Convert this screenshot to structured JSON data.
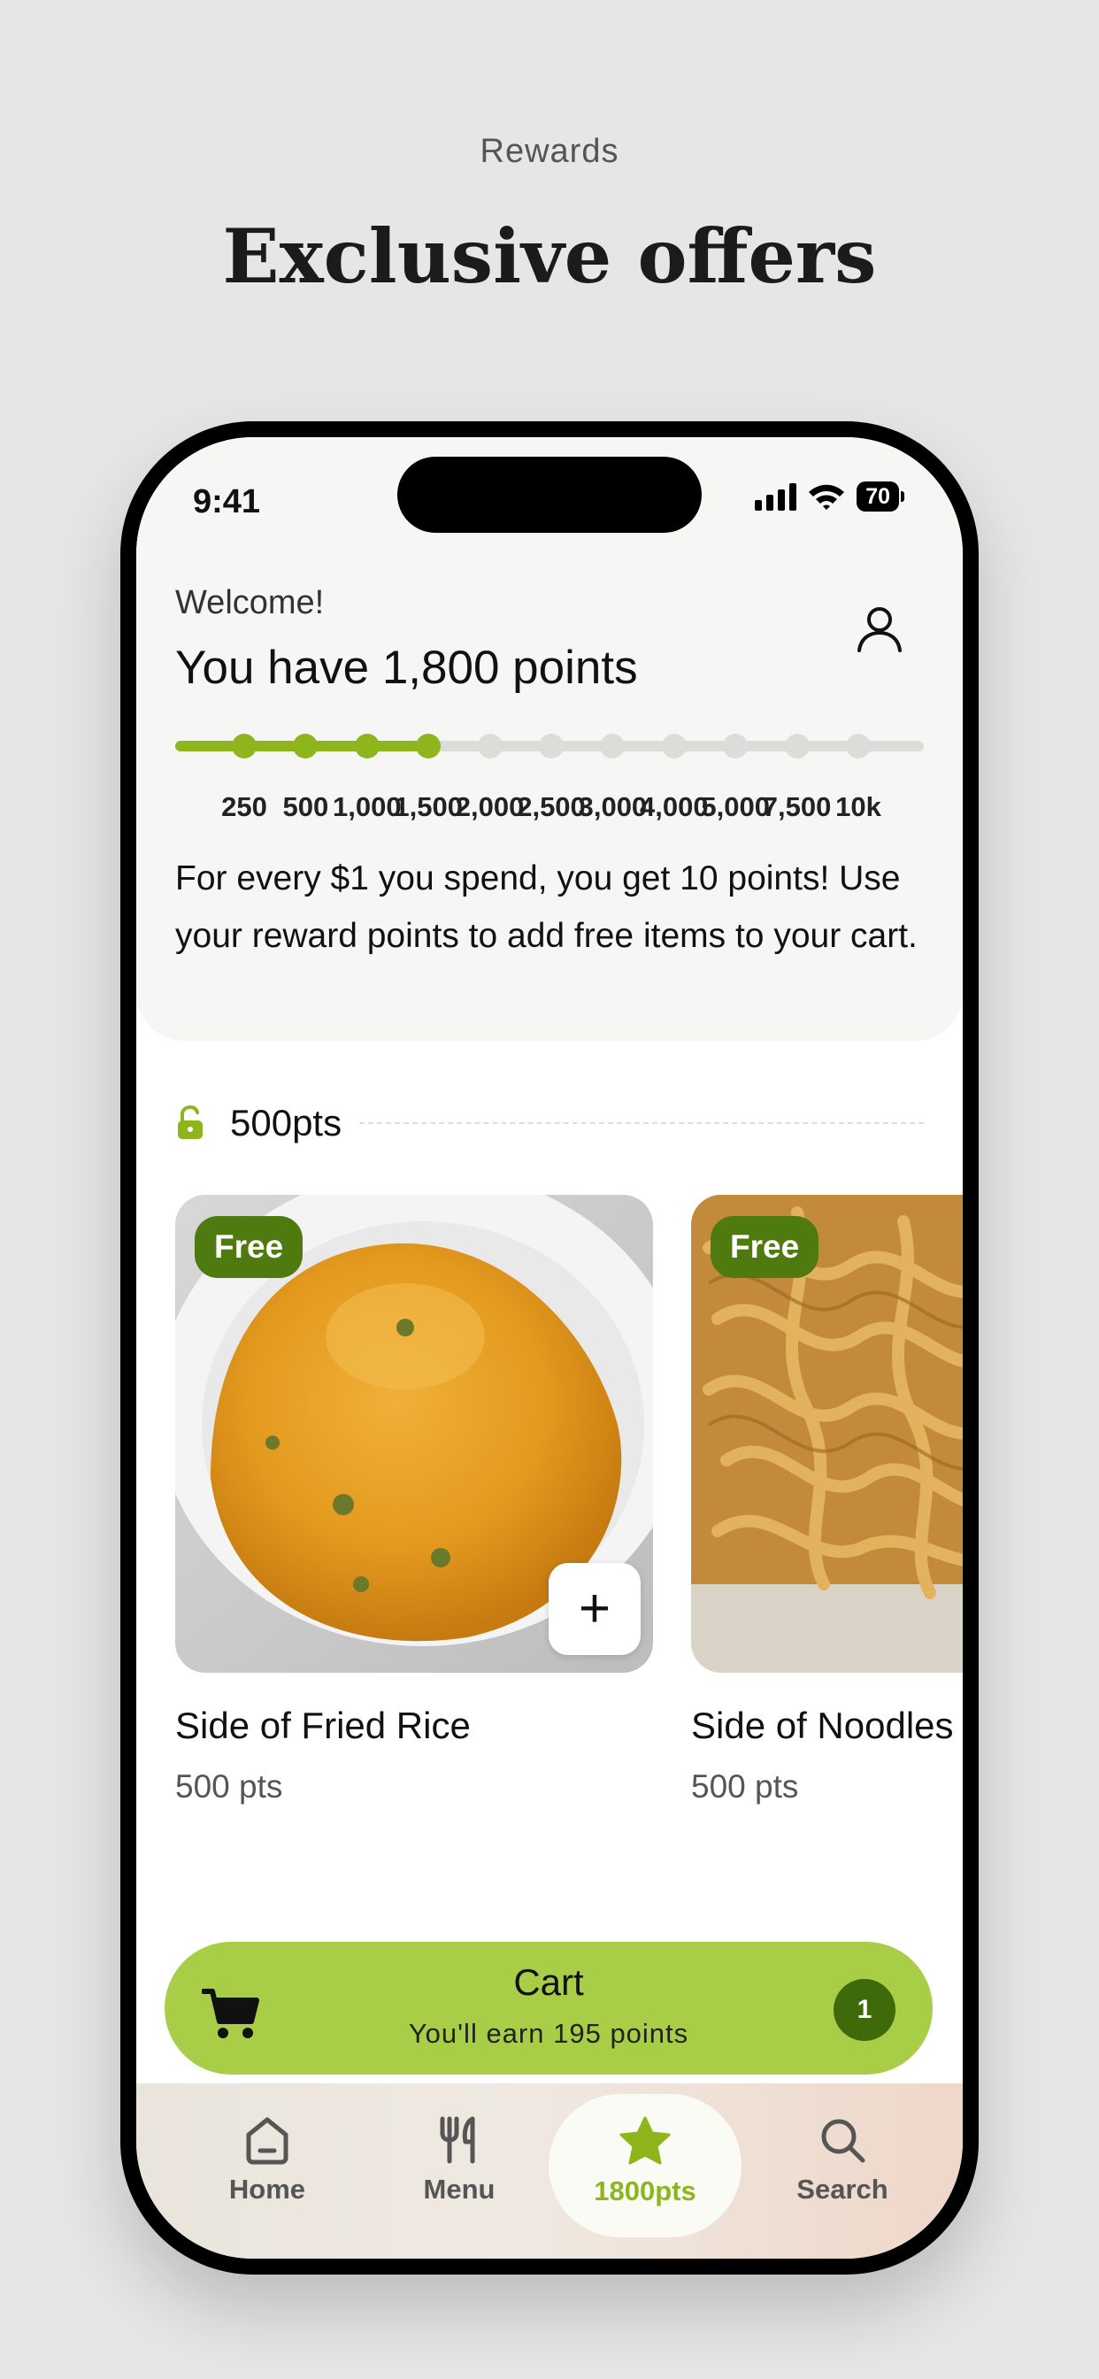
{
  "page": {
    "eyebrow": "Rewards",
    "headline": "Exclusive offers"
  },
  "status_bar": {
    "time": "9:41",
    "battery": "70"
  },
  "header": {
    "welcome": "Welcome!",
    "points_title": "You have 1,800 points",
    "progress": {
      "current_points": 1800,
      "milestones": [
        "250",
        "500",
        "1,000",
        "1,500",
        "2,000",
        "2,500",
        "3,000",
        "4,000",
        "5,000",
        "7,500",
        "10k"
      ],
      "reached_count": 4
    },
    "earn_text": "For every $1 you spend, you get 10 points! Use your reward points to add free items to your cart."
  },
  "tier": {
    "label": "500pts",
    "status": "unlocked"
  },
  "items": [
    {
      "badge": "Free",
      "name": "Side of Fried Rice",
      "points": "500 pts",
      "add_label": "+"
    },
    {
      "badge": "Free",
      "name": "Side of Noodles",
      "points": "500 pts"
    }
  ],
  "cart": {
    "title": "Cart",
    "subtitle": "You'll earn 195 points",
    "count": "1"
  },
  "tabbar": {
    "tabs": [
      {
        "label": "Home",
        "icon": "home-icon"
      },
      {
        "label": "Menu",
        "icon": "fork-knife-icon"
      },
      {
        "label": "1800pts",
        "icon": "star-icon",
        "active": true
      },
      {
        "label": "Search",
        "icon": "search-icon"
      }
    ]
  },
  "colors": {
    "accent": "#8fb51d",
    "cart_bg": "#a8ce47",
    "badge_bg": "#4f7a10",
    "background": "#e6e6e6"
  }
}
